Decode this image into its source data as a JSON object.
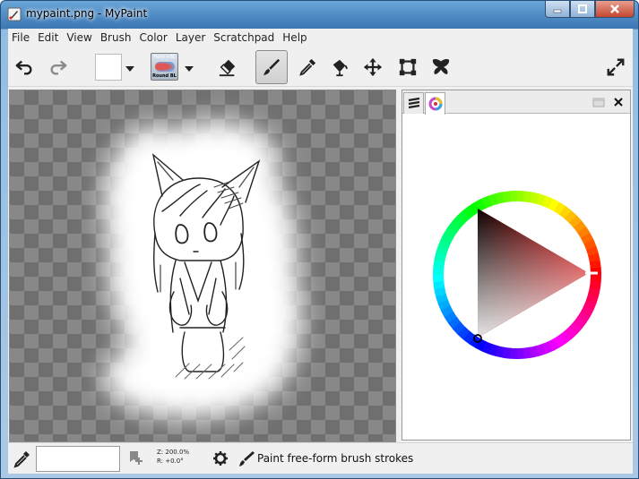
{
  "window": {
    "title": "mypaint.png - MyPaint"
  },
  "menu": [
    "File",
    "Edit",
    "View",
    "Brush",
    "Color",
    "Layer",
    "Scratchpad",
    "Help"
  ],
  "toolbar": {
    "brush_preset_line1": "Paint +BL",
    "brush_preset_line2": "Round BL",
    "active_color": "#ffffff",
    "icons": [
      "undo-icon",
      "redo-icon",
      "eraser-icon",
      "brush-icon",
      "eyedropper-icon",
      "fill-icon",
      "move-icon",
      "frame-icon",
      "symmetry-icon",
      "fullscreen-icon"
    ]
  },
  "panel": {
    "tabs": [
      "layers-icon",
      "color-wheel-icon"
    ],
    "selected_hue_color": "#cc0000"
  },
  "statusbar": {
    "zoom_label": "Z: 200.0%",
    "rotation_label": "R: +0.0°",
    "message": "Paint free-form brush strokes"
  }
}
